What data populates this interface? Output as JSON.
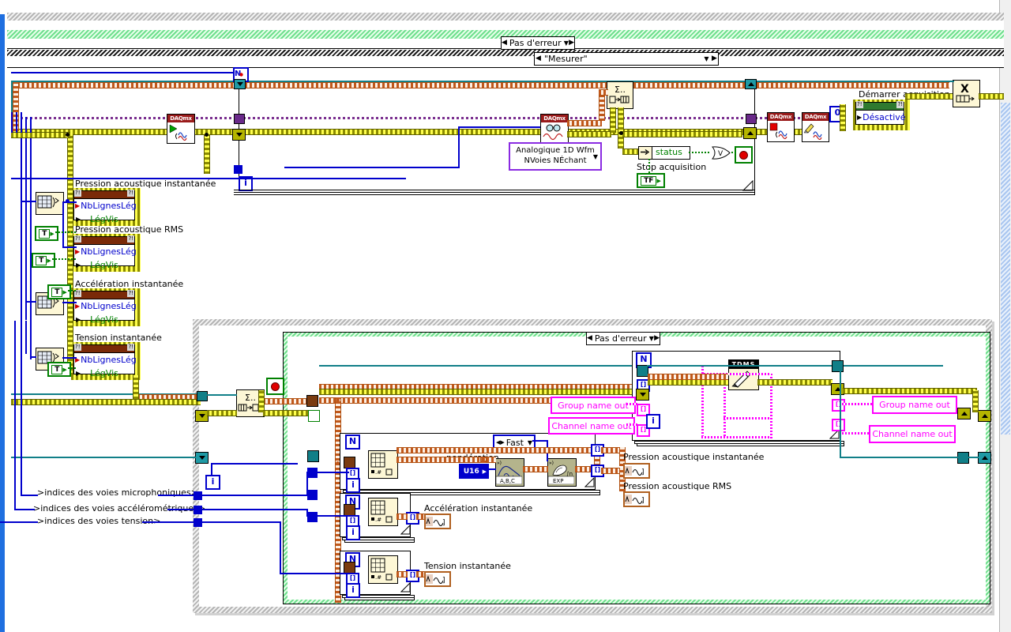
{
  "app": {
    "kind": "labview-block-diagram",
    "language": "fr"
  },
  "selectors": {
    "outer_error_case": "Pas d'erreur",
    "event_case": "\"Mesurer\"",
    "logging_error_case": "Pas d'erreur"
  },
  "labels": {
    "pression_instantanee_1": "Pression acoustique instantanée",
    "pression_rms_1": "Pression acoustique RMS",
    "acceleration_1": "Accélération instantanée",
    "tension_1": "Tension instantanée",
    "demarrer_acquisition": "Démarrer acquisition",
    "stop_acquisition": "Stop acquisition",
    "ponderation": "pondération",
    "pression_instantanee_2": "Pression acoustique instantanée",
    "pression_rms_2": "Pression acoustique RMS",
    "acceleration_2": "Accélération instantanée",
    "tension_2": "Tension instantanée",
    "indices_micro": ">indices des voies microphoniques>",
    "indices_accel": ">indices des voies accélérométriques>",
    "indices_tension": ">indices des voies tension>"
  },
  "property_nodes": [
    {
      "title": "Pression acoustique instantanée",
      "prop1": "NbLignesLég",
      "prop2": "LégVis"
    },
    {
      "title": "Pression acoustique RMS",
      "prop1": "NbLignesLég",
      "prop2": "LégVis"
    },
    {
      "title": "Accélération instantanée",
      "prop1": "NbLignesLég",
      "prop2": "LégVis"
    },
    {
      "title": "Tension instantanée",
      "prop1": "NbLignesLég",
      "prop2": "LégVis"
    }
  ],
  "demarrer_property": {
    "title": "Démarrer acquisition",
    "prop1": "Désactivé"
  },
  "constants": {
    "zero": "0",
    "true_1": "T",
    "true_2": "T",
    "true_3": "T",
    "true_4": "T",
    "stop_false": "TF",
    "u16": "U16"
  },
  "polymorphic_selector": {
    "line1": "Analogique 1D Wfm",
    "line2": "NVoies NÉchant"
  },
  "enum_fast": "Fast",
  "error_cluster_field": "status",
  "string_indicators": {
    "group_name_out_1": "Group name out",
    "channel_name_out_1": "Channel name out",
    "group_name_out_2": "Group name out",
    "channel_name_out_2": "Channel name out"
  },
  "loop_terminals": {
    "count_N": "N",
    "iteration_i": "i"
  },
  "icons": {
    "daqmx_start": "daqmx-start-task-icon",
    "daqmx_read": "daqmx-read-icon",
    "daqmx_stop": "daqmx-stop-task-icon",
    "daqmx_clear": "daqmx-clear-task-icon",
    "tdms_write": "tdms-write-icon",
    "queue_enqueue": "enqueue-element-icon",
    "queue_dequeue": "dequeue-element-icon",
    "release_queue": "release-queue-icon",
    "array_size": "array-size-icon",
    "index_array": "index-array-icon",
    "unbundle": "unbundle-by-name-icon",
    "or_gate": "or-gate-icon",
    "sound_weighting": "sound-level-weighting-filter-icon",
    "exp_averaging": "exponential-averaging-icon",
    "stop_button": "stop-button-icon",
    "waveform_indicator": "waveform-array-indicator-icon"
  },
  "colors": {
    "error_wire": "#8a8a00",
    "dynamic_wire": "#c0581b",
    "string_wire": "#ff00ff",
    "task_wire": "#7a2f8f",
    "refnum_wire": "#117f88",
    "integer_wire": "#0000cc",
    "boolean_wire": "#008000",
    "node_fill": "#fdf7d6",
    "daq_header": "#9a1b1b",
    "property_header": "#7a2a08"
  },
  "release_queue_glyph": "X"
}
